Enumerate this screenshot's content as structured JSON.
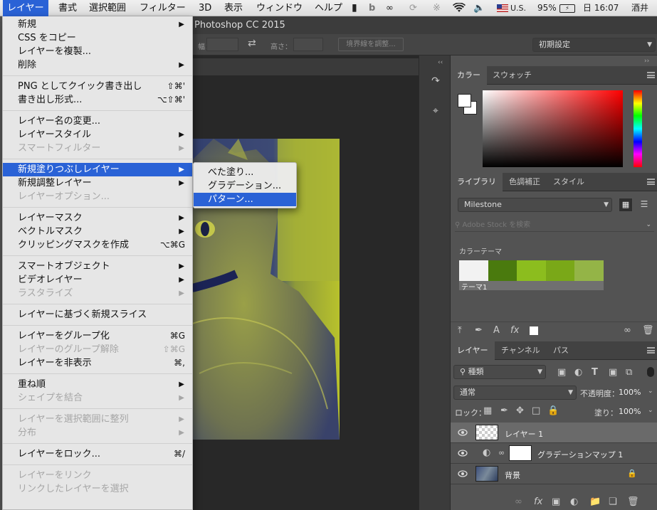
{
  "menubar": {
    "items": [
      "レイヤー",
      "書式",
      "選択範囲",
      "フィルター",
      "3D",
      "表示",
      "ウィンドウ",
      "ヘルプ"
    ],
    "input_source": "U.S.",
    "battery": "95%",
    "clock": "日 16:07",
    "user": "酒井"
  },
  "window": {
    "title": "Photoshop CC 2015"
  },
  "options": {
    "width_label": "幅：",
    "height_label": "高さ：",
    "refine_button": "境界線を調整...",
    "workspace": "初期設定"
  },
  "layer_menu": {
    "groups": [
      [
        {
          "label": "新規",
          "submenu": true
        },
        {
          "label": "CSS をコピー"
        },
        {
          "label": "レイヤーを複製..."
        },
        {
          "label": "削除",
          "submenu": true
        }
      ],
      [
        {
          "label": "PNG としてクイック書き出し",
          "shortcut": "⇧⌘'"
        },
        {
          "label": "書き出し形式...",
          "shortcut": "⌥⇧⌘'"
        }
      ],
      [
        {
          "label": "レイヤー名の変更..."
        },
        {
          "label": "レイヤースタイル",
          "submenu": true
        },
        {
          "label": "スマートフィルター",
          "submenu": true,
          "disabled": true
        }
      ],
      [
        {
          "label": "新規塗りつぶしレイヤー",
          "submenu": true,
          "selected": true
        },
        {
          "label": "新規調整レイヤー",
          "submenu": true
        },
        {
          "label": "レイヤーオプション...",
          "disabled": true
        }
      ],
      [
        {
          "label": "レイヤーマスク",
          "submenu": true
        },
        {
          "label": "ベクトルマスク",
          "submenu": true
        },
        {
          "label": "クリッピングマスクを作成",
          "shortcut": "⌥⌘G"
        }
      ],
      [
        {
          "label": "スマートオブジェクト",
          "submenu": true
        },
        {
          "label": "ビデオレイヤー",
          "submenu": true
        },
        {
          "label": "ラスタライズ",
          "submenu": true,
          "disabled": true
        }
      ],
      [
        {
          "label": "レイヤーに基づく新規スライス"
        }
      ],
      [
        {
          "label": "レイヤーをグループ化",
          "shortcut": "⌘G"
        },
        {
          "label": "レイヤーのグループ解除",
          "shortcut": "⇧⌘G",
          "disabled": true
        },
        {
          "label": "レイヤーを非表示",
          "shortcut": "⌘,"
        }
      ],
      [
        {
          "label": "重ね順",
          "submenu": true
        },
        {
          "label": "シェイプを結合",
          "submenu": true,
          "disabled": true
        }
      ],
      [
        {
          "label": "レイヤーを選択範囲に整列",
          "submenu": true,
          "disabled": true
        },
        {
          "label": "分布",
          "submenu": true,
          "disabled": true
        }
      ],
      [
        {
          "label": "レイヤーをロック...",
          "shortcut": "⌘/"
        }
      ],
      [
        {
          "label": "レイヤーをリンク",
          "disabled": true
        },
        {
          "label": "リンクしたレイヤーを選択",
          "disabled": true
        }
      ]
    ]
  },
  "fill_submenu": {
    "items": [
      "べた塗り...",
      "グラデーション...",
      "パターン..."
    ],
    "selected_index": 2
  },
  "color_panel": {
    "tabs": [
      "カラー",
      "スウォッチ"
    ],
    "active": "カラー"
  },
  "library_panel": {
    "tabs": [
      "ライブラリ",
      "色調補正",
      "スタイル"
    ],
    "library": "Milestone",
    "search_placeholder": "Adobe Stock を検索",
    "section": "カラーテーマ",
    "theme_name": "テーマ1",
    "theme_colors": [
      "#f2f2f2",
      "#4a7a0e",
      "#8cbd1e",
      "#7aa818",
      "#94b447"
    ]
  },
  "layers_panel": {
    "tabs": [
      "レイヤー",
      "チャンネル",
      "パス"
    ],
    "kind_filter": "種類",
    "blend_mode": "通常",
    "opacity_label": "不透明度：",
    "opacity": "100%",
    "lock_label": "ロック：",
    "fill_label": "塗り：",
    "fill": "100%",
    "layers": [
      {
        "name": "レイヤー 1"
      },
      {
        "name": "グラデーションマップ 1"
      },
      {
        "name": "背景"
      }
    ]
  }
}
